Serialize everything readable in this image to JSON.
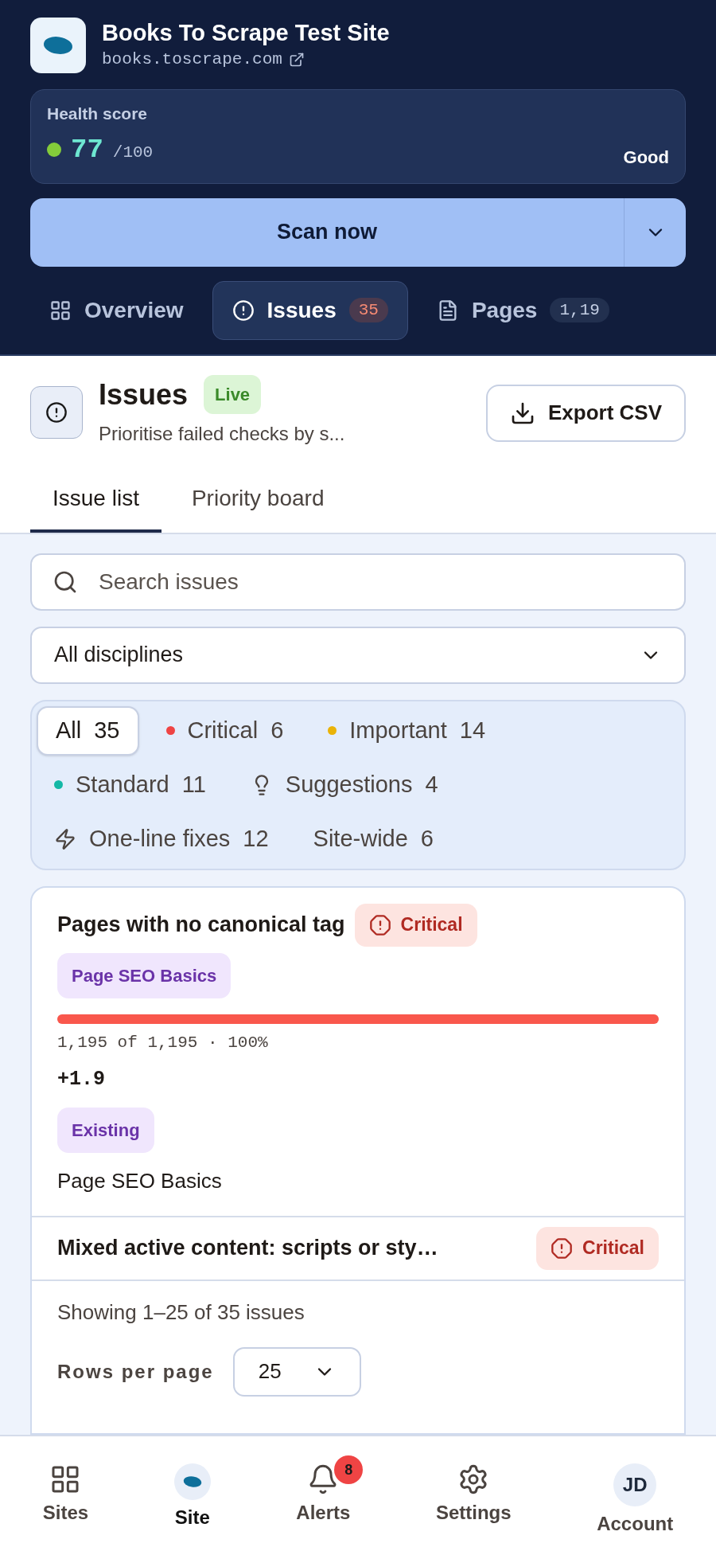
{
  "site": {
    "title": "Books To Scrape Test Site",
    "url": "books.toscrape.com"
  },
  "health": {
    "label": "Health score",
    "score": "77",
    "max": "/100",
    "rating": "Good",
    "color": "#84cc3a"
  },
  "scan_button": {
    "label": "Scan now"
  },
  "nav_tabs": [
    {
      "label": "Overview",
      "kind": "grid",
      "selected": false
    },
    {
      "label": "Issues",
      "kind": "alert",
      "badge": "35",
      "selected": true
    },
    {
      "label": "Pages",
      "kind": "file",
      "badge": "1,19",
      "selected": false
    }
  ],
  "page_header": {
    "title": "Issues",
    "status": "Live",
    "subtitle": "Prioritise failed checks by s...",
    "export_button": "Export CSV"
  },
  "sub_tabs": [
    {
      "label": "Issue list",
      "selected": true
    },
    {
      "label": "Priority board",
      "selected": false
    }
  ],
  "search": {
    "placeholder": "Search issues"
  },
  "discipline_select": {
    "value": "All disciplines"
  },
  "filters": [
    {
      "kind": "plain",
      "label": "All",
      "count": "35",
      "selected": true
    },
    {
      "kind": "dot",
      "label": "Critical",
      "count": "6",
      "color": "#ef4444",
      "selected": false
    },
    {
      "kind": "dot",
      "label": "Important",
      "count": "14",
      "color": "#eab308",
      "selected": false
    },
    {
      "kind": "dot",
      "label": "Standard",
      "count": "11",
      "color": "#14b8a6",
      "selected": false
    },
    {
      "kind": "bulb",
      "label": "Suggestions",
      "count": "4",
      "selected": false
    },
    {
      "kind": "bolt",
      "label": "One-line fixes",
      "count": "12",
      "selected": false
    },
    {
      "kind": "plain",
      "label": "Site-wide",
      "count": "6",
      "selected": false
    }
  ],
  "issues": [
    {
      "title": "Pages with no canonical tag",
      "severity": "Critical",
      "tag": "Page SEO Basics",
      "level": 1.0,
      "affected": "1,195 of 1,195 · 100%",
      "impact": "+1.9",
      "status": "Existing",
      "category": "Page SEO Basics"
    },
    {
      "title": "Mixed active content: scripts or sty…",
      "severity": "Critical"
    }
  ],
  "pagination": {
    "summary": "Showing 1–25 of 35 issues",
    "rows_label": "Rows per page",
    "rows_value": "25"
  },
  "bottom_nav": [
    {
      "label": "Sites",
      "kind": "grid",
      "selected": false
    },
    {
      "label": "Site",
      "kind": "logo",
      "selected": true
    },
    {
      "label": "Alerts",
      "kind": "bell",
      "badge": "8",
      "selected": false
    },
    {
      "label": "Settings",
      "kind": "gear",
      "selected": false
    },
    {
      "label": "Account",
      "kind": "avatar",
      "initials": "JD",
      "selected": false
    }
  ]
}
